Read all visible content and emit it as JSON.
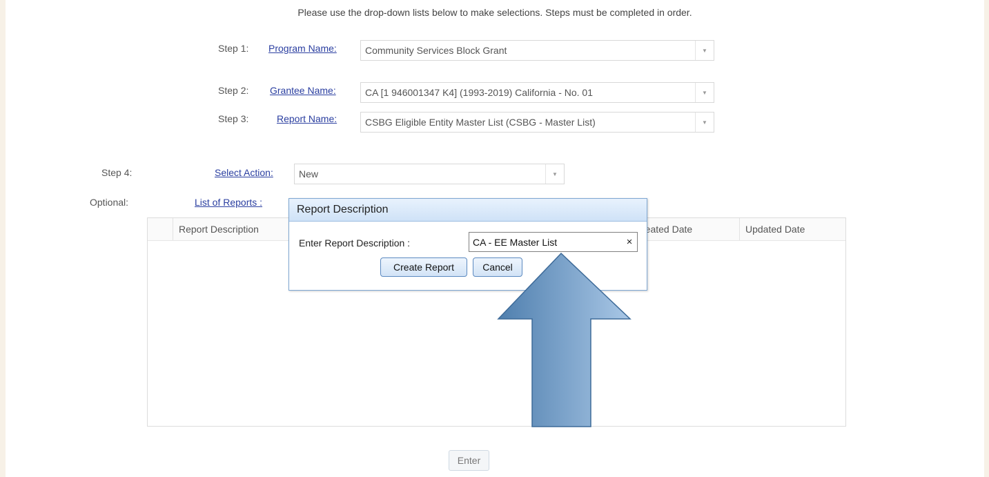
{
  "instructions": "Please use the drop-down lists below to make selections. Steps must be completed in order.",
  "steps": {
    "step1": {
      "label": "Step 1:",
      "link": "Program Name:",
      "value": "Community Services Block Grant"
    },
    "step2": {
      "label": "Step 2:",
      "link": "Grantee Name:",
      "value": "CA [1 946001347 K4] (1993-2019) California - No. 01"
    },
    "step3": {
      "label": "Step 3:",
      "link": "Report Name:",
      "value": "CSBG Eligible Entity Master List (CSBG - Master List)"
    },
    "step4": {
      "label": "Step 4:",
      "link": "Select Action:",
      "value": "New"
    },
    "optional": {
      "label": "Optional:",
      "link": "List of Reports :"
    }
  },
  "grid": {
    "columns": [
      "Report Description",
      "reated Date",
      "Updated Date"
    ]
  },
  "enter_button": "Enter",
  "dialog": {
    "title": "Report Description",
    "field_label": "Enter Report Description :",
    "field_value": "CA - EE Master List",
    "clear_symbol": "×",
    "create_button": "Create Report",
    "cancel_button": "Cancel"
  },
  "icons": {
    "dropdown": "chevron-down-icon",
    "clear": "close-icon",
    "overlay_arrow": "up-arrow-icon"
  },
  "colors": {
    "link": "#2a3ea0",
    "dialog_header": "#cfe2f7",
    "overlay_arrow": "#7fa9cf"
  }
}
